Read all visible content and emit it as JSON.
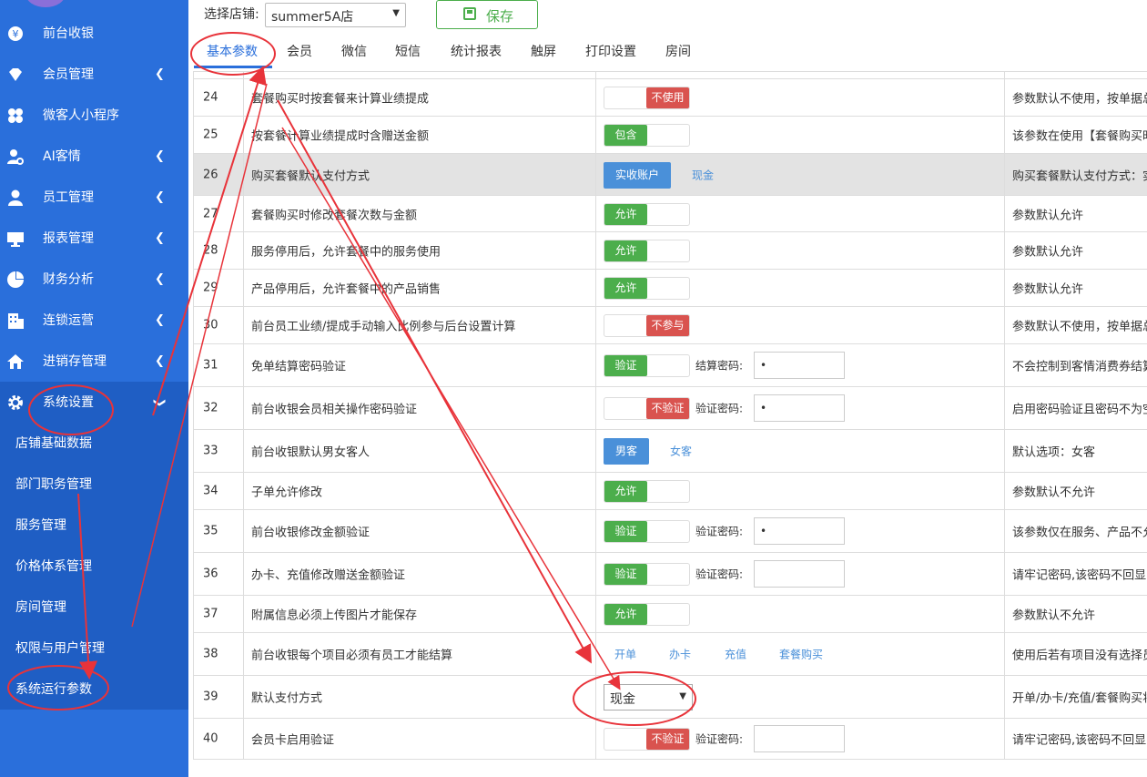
{
  "sidebar": {
    "items": [
      {
        "label": "前台收银",
        "icon": "yen-icon"
      },
      {
        "label": "会员管理",
        "icon": "diamond-icon"
      },
      {
        "label": "微客人小程序",
        "icon": "clover-icon"
      },
      {
        "label": "AI客情",
        "icon": "user-gear-icon"
      },
      {
        "label": "员工管理",
        "icon": "user-icon"
      },
      {
        "label": "报表管理",
        "icon": "monitor-icon"
      },
      {
        "label": "财务分析",
        "icon": "pie-chart-icon"
      },
      {
        "label": "连锁运营",
        "icon": "building-icon"
      },
      {
        "label": "进销存管理",
        "icon": "home-icon"
      },
      {
        "label": "系统设置",
        "icon": "gear-icon"
      }
    ],
    "sub_items": [
      "店铺基础数据",
      "部门职务管理",
      "服务管理",
      "价格体系管理",
      "房间管理",
      "权限与用户管理",
      "系统运行参数"
    ]
  },
  "toolbar": {
    "store_label": "选择店铺:",
    "store_value": "summer5A店",
    "save_label": "保存"
  },
  "tabs": [
    "基本参数",
    "会员",
    "微信",
    "短信",
    "统计报表",
    "触屏",
    "打印设置",
    "房间"
  ],
  "rows": [
    {
      "num": "24",
      "name": "套餐购买时按套餐来计算业绩提成",
      "toggle_off": "不使用",
      "desc": "参数默认不使用，按单据总实"
    },
    {
      "num": "25",
      "name": "按套餐计算业绩提成时含赠送金额",
      "toggle_on": "包含",
      "desc": "该参数在使用【套餐购买时按"
    },
    {
      "num": "26",
      "name": "购买套餐默认支付方式",
      "btn_selected": "实收账户",
      "link1": "现金",
      "desc": "购买套餐默认支付方式：实收"
    },
    {
      "num": "27",
      "name": "套餐购买时修改套餐次数与金额",
      "toggle_on": "允许",
      "desc": "参数默认允许"
    },
    {
      "num": "28",
      "name": "服务停用后，允许套餐中的服务使用",
      "toggle_on": "允许",
      "desc": "参数默认允许"
    },
    {
      "num": "29",
      "name": "产品停用后，允许套餐中的产品销售",
      "toggle_on": "允许",
      "desc": "参数默认允许"
    },
    {
      "num": "30",
      "name": "前台员工业绩/提成手动输入比例参与后台设置计算",
      "toggle_off": "不参与",
      "desc": "参数默认不使用，按单据总实"
    },
    {
      "num": "31",
      "name": "免单结算密码验证",
      "toggle_on": "验证",
      "pw_label": "结算密码:",
      "pw_value": "•",
      "desc": "不会控制到客情消费券结算"
    },
    {
      "num": "32",
      "name": "前台收银会员相关操作密码验证",
      "toggle_off": "不验证",
      "pw_label": "验证密码:",
      "pw_value": "•",
      "desc": "启用密码验证且密码不为空时"
    },
    {
      "num": "33",
      "name": "前台收银默认男女客人",
      "btn_selected": "男客",
      "link1": "女客",
      "desc": "默认选项：女客"
    },
    {
      "num": "34",
      "name": "子单允许修改",
      "toggle_on": "允许",
      "desc": "参数默认不允许"
    },
    {
      "num": "35",
      "name": "前台收银修改金额验证",
      "toggle_on": "验证",
      "pw_label": "验证密码:",
      "pw_value": "•",
      "desc": "该参数仅在服务、产品不允许"
    },
    {
      "num": "36",
      "name": "办卡、充值修改赠送金额验证",
      "toggle_on": "验证",
      "pw_label": "验证密码:",
      "pw_value": "",
      "desc": "请牢记密码,该密码不回显"
    },
    {
      "num": "37",
      "name": "附属信息必须上传图片才能保存",
      "toggle_on": "允许",
      "desc": "参数默认不允许"
    },
    {
      "num": "38",
      "name": "前台收银每个项目必须有员工才能结算",
      "links": [
        "开单",
        "办卡",
        "充值",
        "套餐购买"
      ],
      "desc": "使用后若有项目没有选择员工"
    },
    {
      "num": "39",
      "name": "默认支付方式",
      "select_value": "现金",
      "desc": "开单/办卡/充值/套餐购买将"
    },
    {
      "num": "40",
      "name": "会员卡启用验证",
      "toggle_off": "不验证",
      "pw_label": "验证密码:",
      "pw_value": "",
      "desc": "请牢记密码,该密码不回显"
    }
  ],
  "colors": {
    "sidebar": "#2a6fdb",
    "submenu": "#1f5ec4",
    "green": "#4cae4c",
    "red": "#d9534f",
    "blue": "#4a90d9",
    "annotation": "#e8333a"
  }
}
